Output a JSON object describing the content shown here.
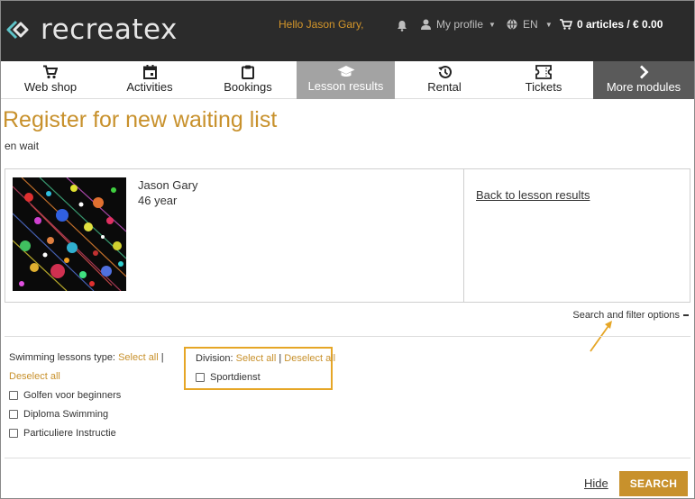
{
  "header": {
    "logo_text": "recreatex",
    "greeting": "Hello Jason Gary,",
    "profile_label": "My profile",
    "language": "EN",
    "cart": "0 articles / € 0.00"
  },
  "nav": {
    "items": [
      {
        "label": "Web shop",
        "icon": "cart-icon"
      },
      {
        "label": "Activities",
        "icon": "calendar-icon"
      },
      {
        "label": "Bookings",
        "icon": "clipboard-icon"
      },
      {
        "label": "Lesson results",
        "icon": "graduation-cap-icon",
        "active": true
      },
      {
        "label": "Rental",
        "icon": "history-icon"
      },
      {
        "label": "Tickets",
        "icon": "ticket-icon"
      },
      {
        "label": "More modules",
        "icon": "chevron-right-icon"
      }
    ]
  },
  "page": {
    "title": "Register for new waiting list",
    "subtitle": "en wait"
  },
  "person": {
    "name": "Jason Gary",
    "age": "46 year"
  },
  "back_link": "Back to lesson results",
  "filter_toggle": "Search and filter options",
  "filters": {
    "swimming": {
      "label": "Swimming lessons type:",
      "select_all": "Select all",
      "deselect_all": "Deselect all",
      "separator": "|",
      "options": [
        "Golfen voor beginners",
        "Diploma Swimming",
        "Particuliere Instructie"
      ]
    },
    "division": {
      "label": "Division:",
      "select_all": "Select all",
      "deselect_all": "Deselect all",
      "separator": "|",
      "options": [
        "Sportdienst"
      ]
    }
  },
  "actions": {
    "hide": "Hide",
    "search": "SEARCH"
  },
  "colors": {
    "accent": "#c8912c",
    "topbar": "#2b2b2b",
    "highlight_border": "#e6a626"
  }
}
